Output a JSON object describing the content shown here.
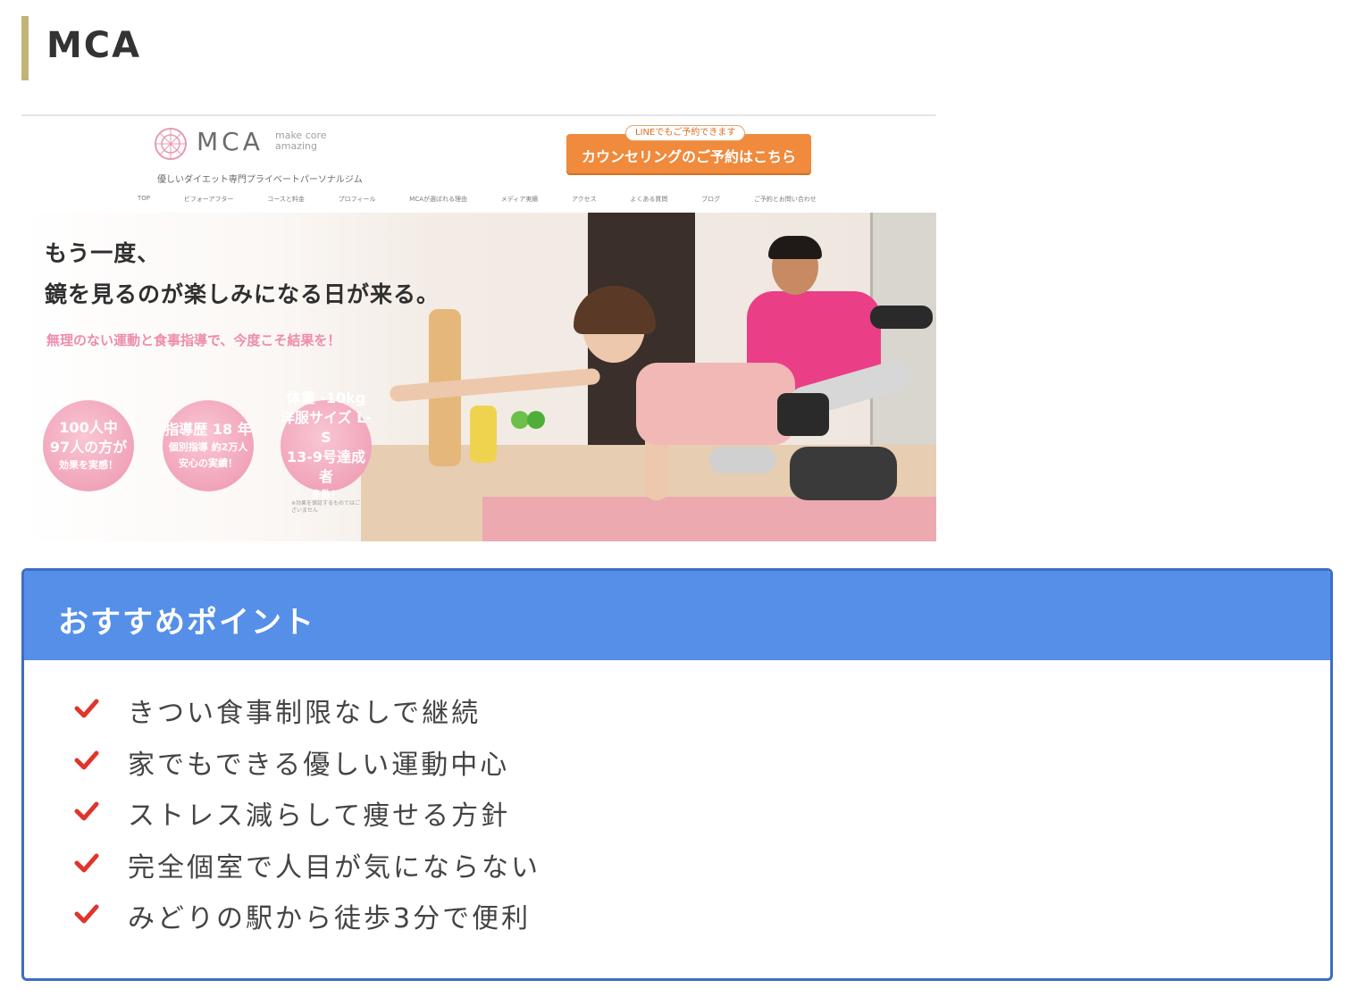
{
  "section": {
    "title": "MCA"
  },
  "site": {
    "logo_text": "MCA",
    "logo_sub": "make core amazing",
    "tagline": "優しいダイエット専門プライベートパーソナルジム",
    "line_badge": "LINEでもご予約できます",
    "cta": "カウンセリングのご予約はこちら",
    "nav": [
      "TOP",
      "ビフォーアフター",
      "コースと料金",
      "プロフィール",
      "MCAが選ばれる理由",
      "メディア実績",
      "アクセス",
      "よくある質問",
      "ブログ",
      "ご予約とお問い合わせ"
    ],
    "hero": {
      "line1": "もう一度、",
      "line2": "鏡を見るのが楽しみになる日が来る。",
      "sub": "無理のない運動と食事指導で、今度こそ結果を！",
      "badges": [
        {
          "l1": "100人中",
          "l2": "97人の方が",
          "l3": "効果を実感！"
        },
        {
          "l1": "指導歴 18 年",
          "l2": "個別指導 約2万人",
          "l3": "安心の実績！"
        },
        {
          "l1": "体重 -10kg",
          "l2": "洋服サイズ L-S",
          "l3": "13-9号達成者",
          "l4": "多数！"
        }
      ],
      "note": "※効果を保証するものではございません"
    }
  },
  "recommend": {
    "title": "おすすめポイント",
    "items": [
      "きつい食事制限なしで継続",
      "家でもできる優しい運動中心",
      "ストレス減らして痩せる方針",
      "完全個室で人目が気にならない",
      "みどりの駅から徒歩3分で便利"
    ],
    "check_color": "#e0352b",
    "header_color": "#558fe8"
  }
}
